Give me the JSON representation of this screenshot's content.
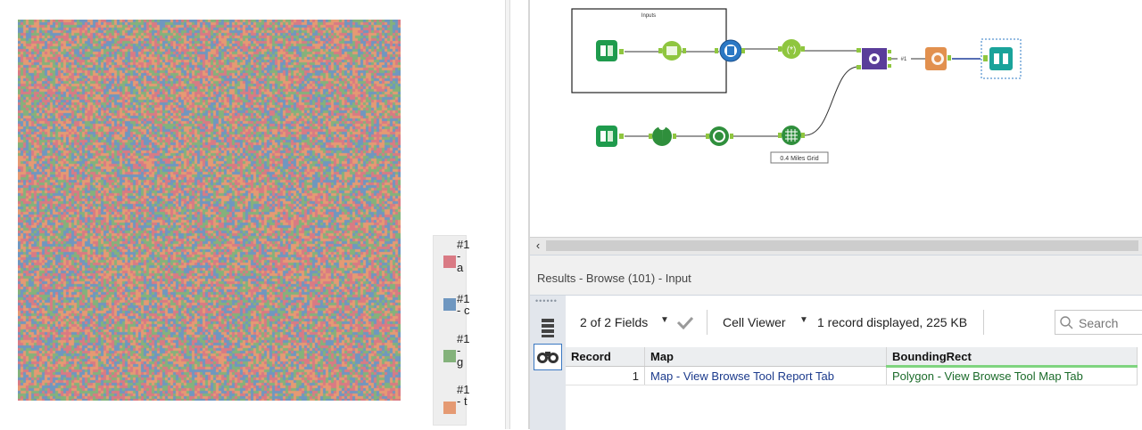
{
  "legend": {
    "items": [
      {
        "label": "#1\n-\na",
        "color": "#d97a84"
      },
      {
        "label": "#1\n- c",
        "color": "#6f97c0"
      },
      {
        "label": "#1\n-\ng",
        "color": "#84b27b"
      },
      {
        "label": "#1\n- t",
        "color": "#e59a73"
      }
    ]
  },
  "workflow": {
    "container_label": "Inputs",
    "grid_annotation": "0.4 Miles Grid",
    "connection_label": "#1"
  },
  "results": {
    "title": "Results - Browse (101) - Input",
    "fields_label": "2 of 2 Fields",
    "cell_viewer_label": "Cell Viewer",
    "status": "1 record displayed, 225 KB",
    "search_placeholder": "Search",
    "columns": [
      "Record",
      "Map",
      "BoundingRect"
    ],
    "rows": [
      {
        "record": "1",
        "map": "Map - View Browse Tool Report Tab",
        "bounding": "Polygon - View Browse Tool Map Tab"
      }
    ]
  },
  "colors": {
    "tool_green": "#8fc63f",
    "tool_green_dark": "#2f8f3c",
    "tool_orange": "#e2904e",
    "tool_blue": "#2b78c4",
    "tool_purple": "#5a3d9a",
    "browse_teal": "#1aa39a"
  },
  "icons": {
    "scroll_left": "‹",
    "grip": "••••••",
    "caret": "▼"
  }
}
